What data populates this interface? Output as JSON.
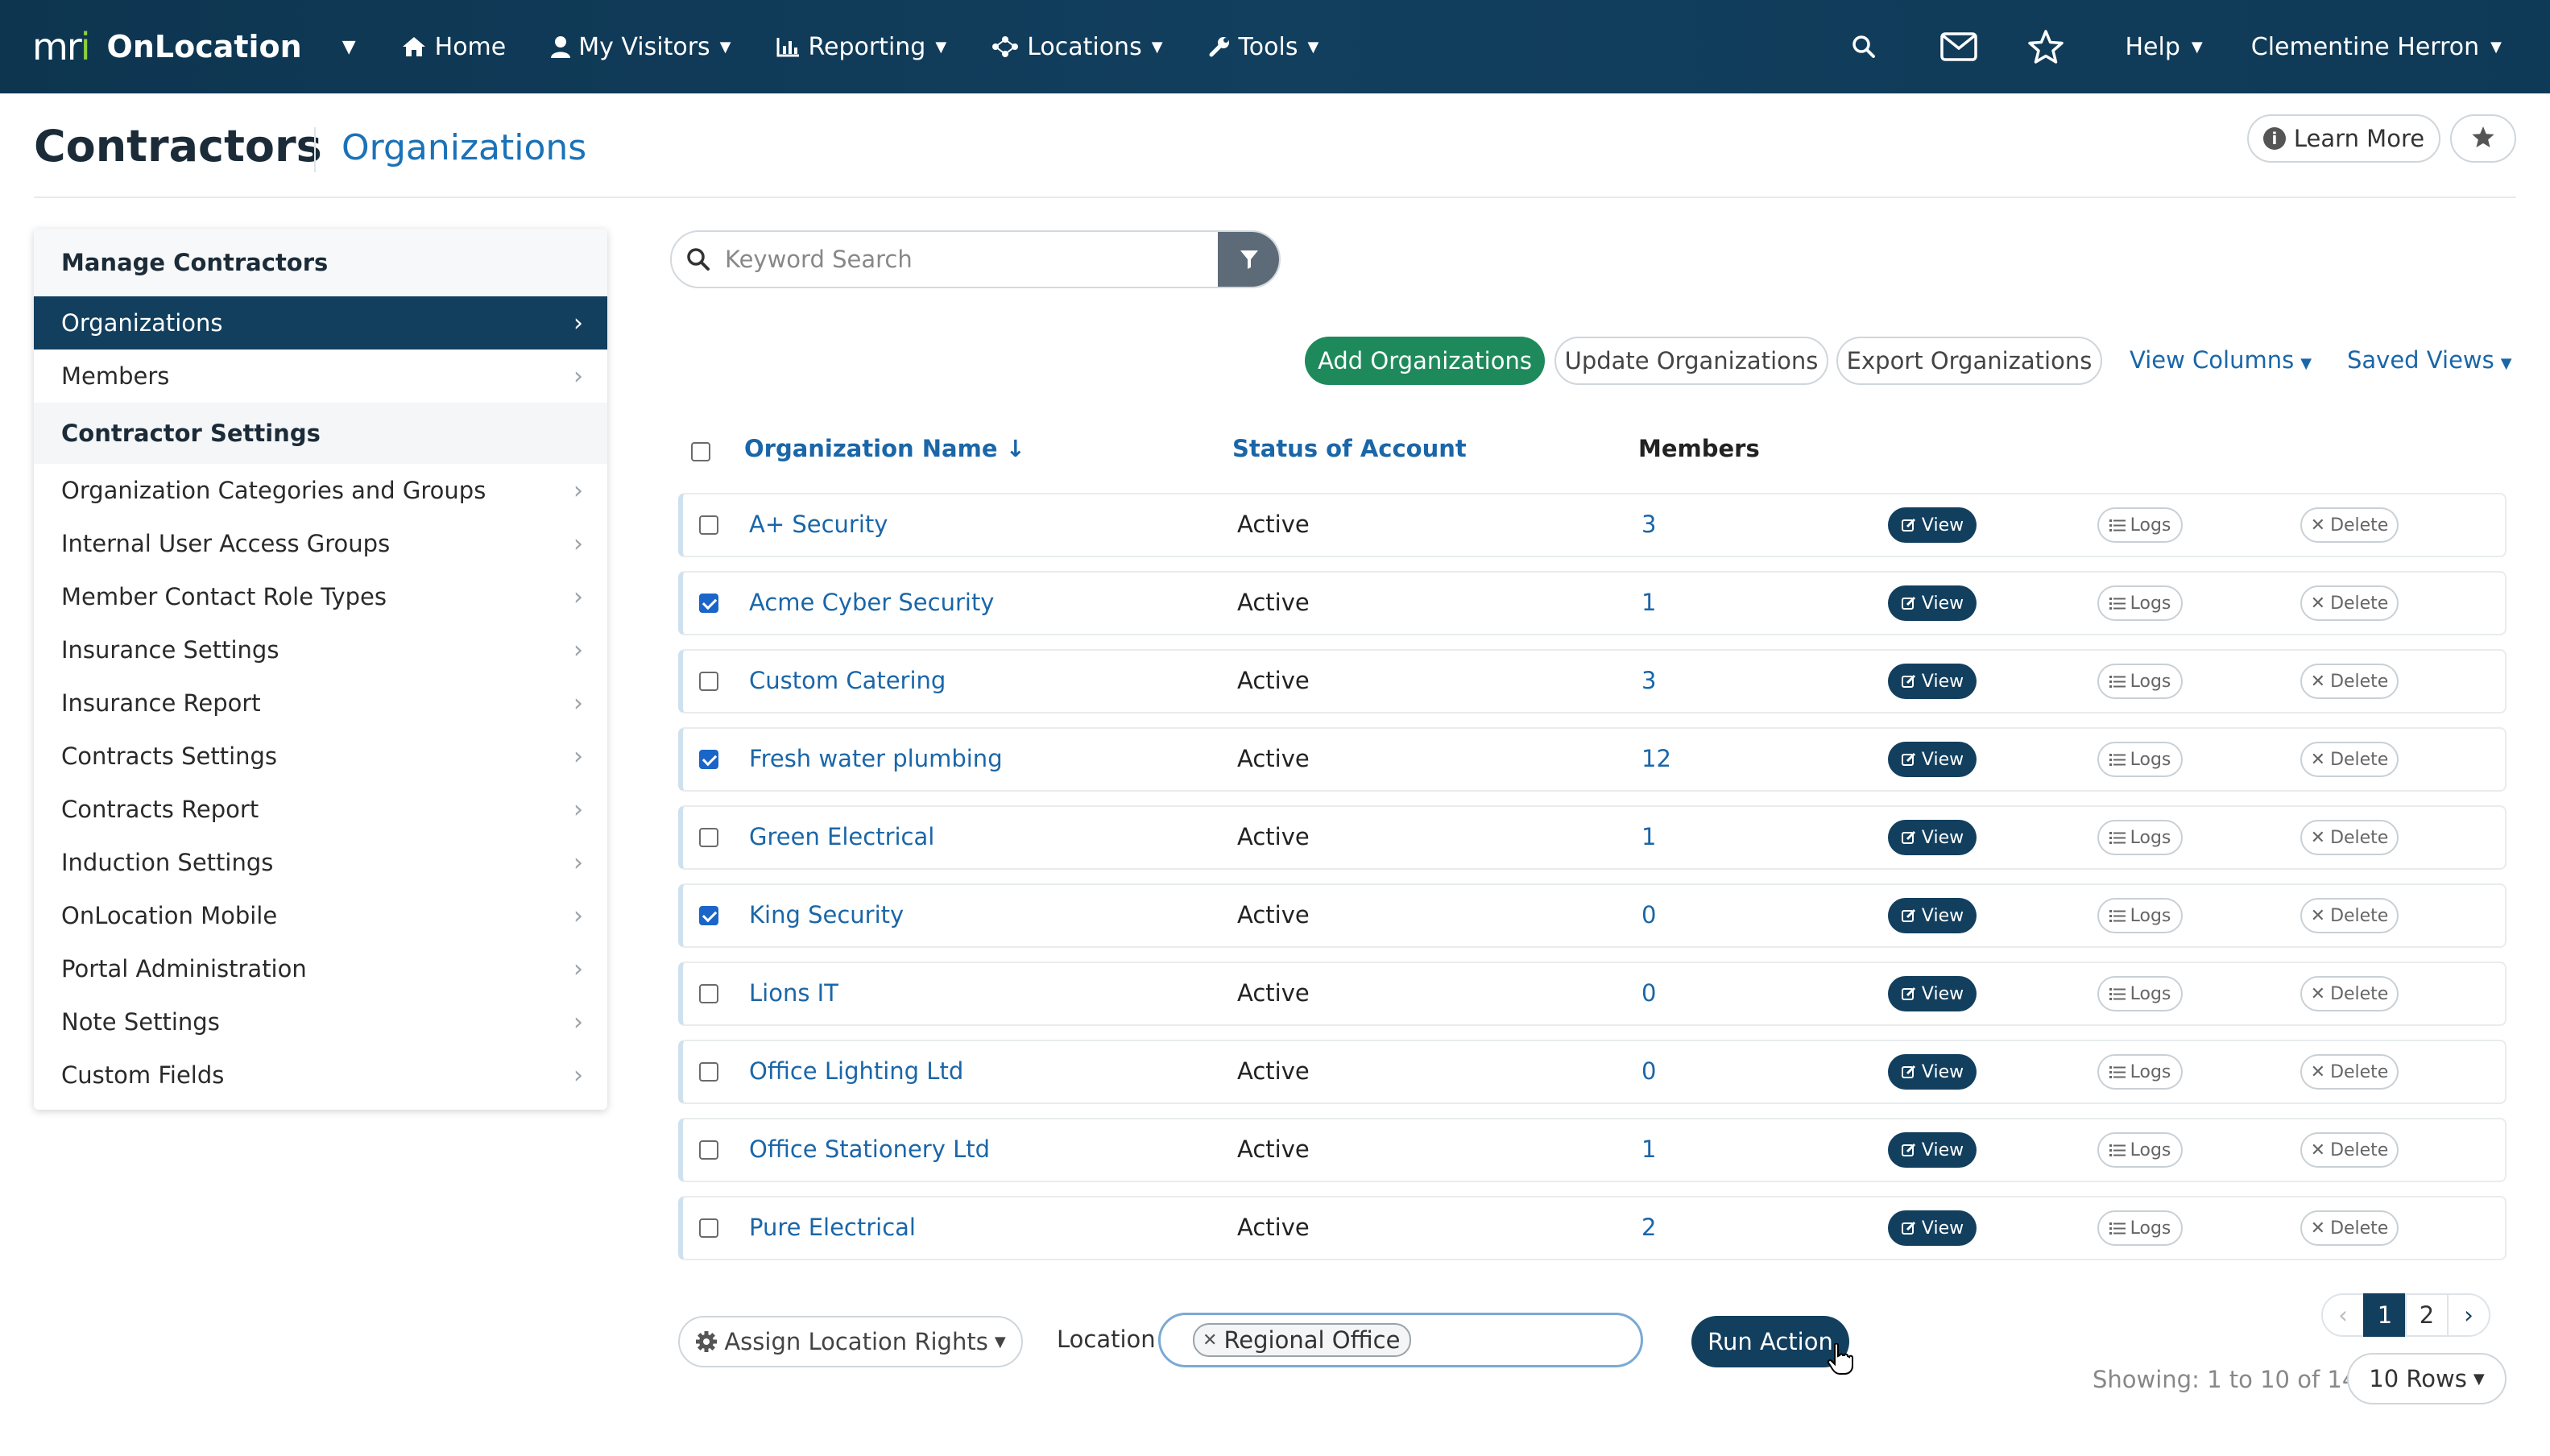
{
  "nav": {
    "brand_logo_a": "m",
    "brand_logo_b": "r",
    "brand_logo_c": "i",
    "brand_name": "OnLocation",
    "items": [
      {
        "label": "Home",
        "icon": "home-icon"
      },
      {
        "label": "My Visitors",
        "icon": "user-icon"
      },
      {
        "label": "Reporting",
        "icon": "chart-icon"
      },
      {
        "label": "Locations",
        "icon": "network-icon"
      },
      {
        "label": "Tools",
        "icon": "wrench-icon"
      }
    ],
    "help_label": "Help",
    "user_name": "Clementine Herron"
  },
  "header": {
    "title": "Contractors",
    "subtitle": "Organizations",
    "learn_more_label": "Learn More"
  },
  "sidebar": {
    "section1": "Manage Contractors",
    "items1": [
      "Organizations",
      "Members"
    ],
    "section2": "Contractor Settings",
    "items2": [
      "Organization Categories and Groups",
      "Internal User Access Groups",
      "Member Contact Role Types",
      "Insurance Settings",
      "Insurance Report",
      "Contracts Settings",
      "Contracts Report",
      "Induction Settings",
      "OnLocation Mobile",
      "Portal Administration",
      "Note Settings",
      "Custom Fields"
    ]
  },
  "search": {
    "placeholder": "Keyword Search"
  },
  "actions": {
    "add": "Add Organizations",
    "update": "Update Organizations",
    "export": "Export Organizations",
    "view_columns": "View Columns",
    "saved_views": "Saved Views"
  },
  "table": {
    "headers": {
      "name": "Organization Name ↓",
      "status": "Status of Account",
      "members": "Members"
    },
    "view_label": "View",
    "logs_label": "Logs",
    "delete_label": "Delete",
    "rows": [
      {
        "name": "A+ Security",
        "status": "Active",
        "members": "3",
        "checked": false
      },
      {
        "name": "Acme Cyber Security",
        "status": "Active",
        "members": "1",
        "checked": true
      },
      {
        "name": "Custom Catering",
        "status": "Active",
        "members": "3",
        "checked": false
      },
      {
        "name": "Fresh water plumbing",
        "status": "Active",
        "members": "12",
        "checked": true
      },
      {
        "name": "Green Electrical",
        "status": "Active",
        "members": "1",
        "checked": false
      },
      {
        "name": "King Security",
        "status": "Active",
        "members": "0",
        "checked": true
      },
      {
        "name": "Lions IT",
        "status": "Active",
        "members": "0",
        "checked": false
      },
      {
        "name": "Office Lighting Ltd",
        "status": "Active",
        "members": "0",
        "checked": false
      },
      {
        "name": "Office Stationery Ltd",
        "status": "Active",
        "members": "1",
        "checked": false
      },
      {
        "name": "Pure Electrical",
        "status": "Active",
        "members": "2",
        "checked": false
      }
    ]
  },
  "bottom": {
    "assign_label": "Assign Location Rights",
    "location_label": "Location",
    "location_chip": "Regional Office",
    "run_label": "Run Action",
    "pages": [
      "1",
      "2"
    ],
    "current_page": "1",
    "showing": "Showing: 1 to 10 of 14",
    "rows_label": "10 Rows"
  },
  "colors": {
    "nav_bg": "#123f5e",
    "accent_green": "#1e8a5b",
    "link_blue": "#1a66a8",
    "logo_green": "#8ccf3f"
  }
}
